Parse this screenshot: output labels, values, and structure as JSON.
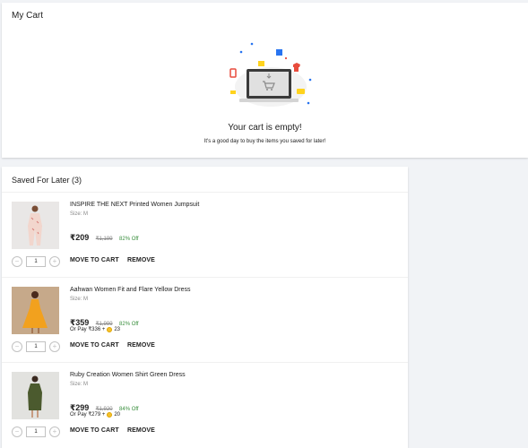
{
  "cart": {
    "title": "My Cart",
    "empty_title": "Your cart is empty!",
    "empty_subtitle": "It's a good day to buy the items you saved for later!"
  },
  "saved": {
    "title": "Saved For Later (3)",
    "items": [
      {
        "name": "INSPIRE THE NEXT Printed Women Jumpsuit",
        "size": "Size: M",
        "price": "₹209",
        "mrp": "₹1,199",
        "discount": "82% Off",
        "pay_prefix": "",
        "pay_coins": "",
        "qty": "1",
        "thumb_icon": "jumpsuit-image"
      },
      {
        "name": "Aahwan Women Fit and Flare Yellow Dress",
        "size": "Size: M",
        "price": "₹359",
        "mrp": "₹1,999",
        "discount": "82% Off",
        "pay_prefix": "Or Pay ₹336 +",
        "pay_coins": "23",
        "qty": "1",
        "thumb_icon": "yellow-dress-image"
      },
      {
        "name": "Ruby Creation Women Shirt Green Dress",
        "size": "Size: M",
        "price": "₹299",
        "mrp": "₹1,920",
        "discount": "84% Off",
        "pay_prefix": "Or Pay ₹279 +",
        "pay_coins": "20",
        "qty": "1",
        "thumb_icon": "green-dress-image"
      }
    ],
    "move_label": "MOVE TO CART",
    "remove_label": "REMOVE",
    "minus_label": "−",
    "plus_label": "+"
  },
  "colors": {
    "discount": "#388e3c",
    "page_bg": "#f1f3f6"
  }
}
